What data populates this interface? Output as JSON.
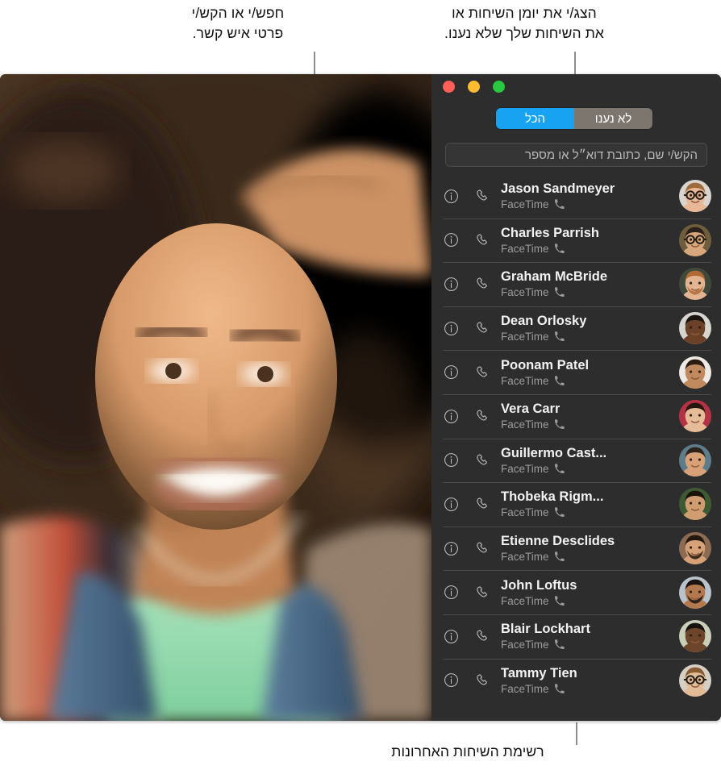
{
  "annotations": {
    "top_right": "הצג/י את יומן השיחות או\nאת השיחות שלך שלא נענו.",
    "top_left": "חפש/י או הקש/י\nפרטי איש קשר.",
    "bottom": "רשימת השיחות האחרונות"
  },
  "window": {
    "traffic_lights": {
      "green_label": "green-traffic-light",
      "yellow_label": "yellow-traffic-light",
      "red_label": "red-traffic-light",
      "green_color": "#28c840",
      "yellow_color": "#febc2e",
      "red_color": "#ff5f57"
    },
    "segmented_control": {
      "active_color": "#17a3f2",
      "inactive_color": "#7d766e",
      "options": [
        {
          "label": "לא נענו",
          "active": false
        },
        {
          "label": "הכל",
          "active": true
        }
      ]
    },
    "search": {
      "placeholder": "הקש/י שם, כתובת דוא״ל או מספר",
      "value": ""
    },
    "call_list": {
      "rows": [
        {
          "name": "Jason Sandmeyer",
          "service": "FaceTime",
          "avatar_bg": "#d9d4cd",
          "skin": "#e8b896",
          "hair": "#9d6a3c",
          "glasses": true,
          "beard": false
        },
        {
          "name": "Charles Parrish",
          "service": "FaceTime",
          "avatar_bg": "#6f5d3e",
          "skin": "#d8a87c",
          "hair": "#2a2118",
          "glasses": true,
          "beard": false
        },
        {
          "name": "Graham McBride",
          "service": "FaceTime",
          "avatar_bg": "#3f4a3a",
          "skin": "#e3b491",
          "hair": "#b16a34",
          "glasses": false,
          "beard": true
        },
        {
          "name": "Dean Orlosky",
          "service": "FaceTime",
          "avatar_bg": "#d8d4cf",
          "skin": "#6b4227",
          "hair": "#1c1410",
          "glasses": false,
          "beard": false
        },
        {
          "name": "Poonam Patel",
          "service": "FaceTime",
          "avatar_bg": "#efeae4",
          "skin": "#c08a5e",
          "hair": "#2b1c12",
          "glasses": false,
          "beard": false
        },
        {
          "name": "Vera Carr",
          "service": "FaceTime",
          "avatar_bg": "#b53245",
          "skin": "#e6bb97",
          "hair": "#241710",
          "glasses": false,
          "beard": false
        },
        {
          "name": "Guillermo Cast...",
          "service": "FaceTime",
          "avatar_bg": "#5d7c8c",
          "skin": "#d8a178",
          "hair": "#2e231b",
          "glasses": false,
          "beard": false
        },
        {
          "name": "Thobeka Rigm...",
          "service": "FaceTime",
          "avatar_bg": "#3e5a33",
          "skin": "#cf9d6f",
          "hair": "#1b120c",
          "glasses": false,
          "beard": false
        },
        {
          "name": "Etienne Desclides",
          "service": "FaceTime",
          "avatar_bg": "#8d6b52",
          "skin": "#d7a177",
          "hair": "#241911",
          "glasses": false,
          "beard": true
        },
        {
          "name": "John Loftus",
          "service": "FaceTime",
          "avatar_bg": "#b9c3cc",
          "skin": "#b3794e",
          "hair": "#1a1310",
          "glasses": false,
          "beard": true
        },
        {
          "name": "Blair Lockhart",
          "service": "FaceTime",
          "avatar_bg": "#c9cfb8",
          "skin": "#6d452a",
          "hair": "#171210",
          "glasses": false,
          "beard": false
        },
        {
          "name": "Tammy Tien",
          "service": "FaceTime",
          "avatar_bg": "#d6cfc4",
          "skin": "#e4bb97",
          "hair": "#8a5c33",
          "glasses": true,
          "beard": false
        }
      ],
      "info_icon": "info-circle-icon",
      "call_icon": "phone-handset-icon",
      "service_icon": "phone-small-icon"
    }
  }
}
